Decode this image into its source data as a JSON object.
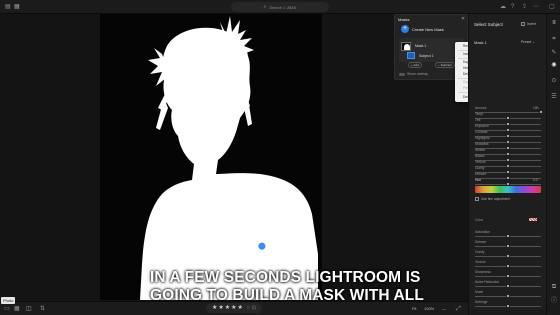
{
  "search": {
    "text": "Search 1 JBAS",
    "icon": "magnifier-icon"
  },
  "topbar": {
    "left_icons": [
      "sidebar-icon",
      "grid-icon"
    ],
    "right_icons": [
      "cloud-icon",
      "help-icon",
      "share-icon",
      "more-icon"
    ]
  },
  "subtitle": {
    "line1": "IN A FEW SECONDS LIGHTROOM IS",
    "line2": "GOING TO BUILD A MASK WITH ALL"
  },
  "bottombar": {
    "tooltip": "Photo",
    "rating_stars": 5,
    "rating_star_glyph": "★",
    "flag_text": "☆ ⊡",
    "zoom_fit": "Fit",
    "zoom_pct": "100%",
    "zoom_sep": "—"
  },
  "masks_panel": {
    "title": "Masks",
    "create_label": "Create New Mask",
    "create_glyph": "+",
    "mask_name": "Mask 1",
    "component_name": "Subtract",
    "subject_name": "Subject 1",
    "add_label": "+ Add",
    "subtract_label": "− Subtract",
    "overlay_label": "Show overlay"
  },
  "context_menu": {
    "items": [
      {
        "label": "Rename",
        "dim": false
      },
      {
        "label": "Invert Subject Selection",
        "shortcut": "Ctrl+I",
        "dim": false
      },
      {
        "label": "Duplicate \"Mask 1\"",
        "dim": false
      },
      {
        "label": "Hide",
        "dim": false
      },
      {
        "label": "Delete \"Mask 1\"",
        "dim": false
      },
      {
        "label": "Copy",
        "dim": true
      },
      {
        "label": "Paste",
        "dim": true
      },
      {
        "label": "Delete All Masks",
        "dim": false
      }
    ]
  },
  "right_panel": {
    "heading": "Select Subject",
    "invert_label": "Invert",
    "mask_label": "Mask 1",
    "preset_label": "Preset ⌄",
    "sliders": [
      {
        "label": "Amount",
        "value": "100",
        "pos": 1.0,
        "bright": false
      },
      {
        "label": "Temp",
        "value": "",
        "pos": 0.5,
        "bright": false
      },
      {
        "label": "Tint",
        "value": "",
        "pos": 0.5,
        "bright": false
      },
      {
        "label": "Exposure",
        "value": "",
        "pos": 0.5,
        "bright": false
      },
      {
        "label": "Contrast",
        "value": "",
        "pos": 0.5,
        "bright": false
      },
      {
        "label": "Highlights",
        "value": "",
        "pos": 0.5,
        "bright": false
      },
      {
        "label": "Shadows",
        "value": "",
        "pos": 0.5,
        "bright": false
      },
      {
        "label": "Whites",
        "value": "",
        "pos": 0.5,
        "bright": false
      },
      {
        "label": "Blacks",
        "value": "",
        "pos": 0.5,
        "bright": false
      },
      {
        "label": "Texture",
        "value": "",
        "pos": 0.5,
        "bright": false
      },
      {
        "label": "Clarity",
        "value": "",
        "pos": 0.5,
        "bright": false
      },
      {
        "label": "Dehaze",
        "value": "",
        "pos": 0.5,
        "bright": false
      },
      {
        "label": "Hue",
        "value": "0.0",
        "pos": 0.5,
        "bright": true
      },
      {
        "label": "Saturation",
        "value": "",
        "pos": 0.5,
        "bright": false
      }
    ],
    "hue_section_label": "Hue",
    "fine_adjust_label": "Use fine adjustment",
    "color_label": "Color",
    "lower_sliders": [
      {
        "label": "Saturation",
        "value": "",
        "pos": 0.5
      },
      {
        "label": "Dehaze",
        "value": "",
        "pos": 0.5
      },
      {
        "label": "Clarity",
        "value": "",
        "pos": 0.5
      },
      {
        "label": "Texture",
        "value": "",
        "pos": 0.5
      },
      {
        "label": "Sharpness",
        "value": "",
        "pos": 0.5
      },
      {
        "label": "Noise Reduction",
        "value": "",
        "pos": 0.5
      },
      {
        "label": "Moiré",
        "value": "",
        "pos": 0.5
      },
      {
        "label": "Defringe",
        "value": "",
        "pos": 0.5
      }
    ]
  },
  "strip_icons": [
    "edit-icon",
    "crop-icon",
    "heal-icon",
    "mask-icon",
    "redeye-icon",
    "presets-icon",
    "versions-icon",
    "info-icon"
  ],
  "colors": {
    "accent": "#2f7fe0",
    "panel": "#1e1e1e",
    "canvas": "#141414",
    "mask_white": "#ffffff"
  }
}
